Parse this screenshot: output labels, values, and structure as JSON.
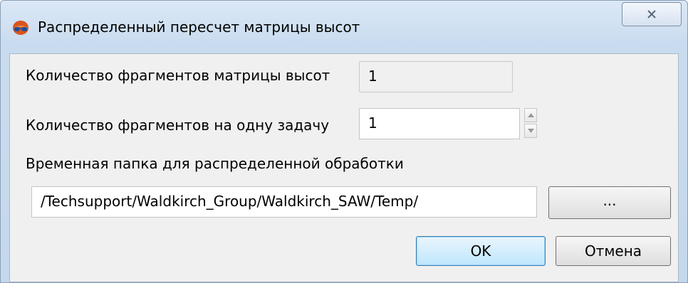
{
  "window": {
    "title": "Распределенный пересчет матрицы высот",
    "icon": "stereo-glasses-icon",
    "close_icon": "close-icon"
  },
  "form": {
    "fragments_count_label": "Количество фрагментов матрицы высот",
    "fragments_count_value": "1",
    "fragments_per_task_label": "Количество фрагментов на одну задачу",
    "fragments_per_task_value": "1",
    "temp_folder_label": "Временная папка для распределенной обработки",
    "temp_folder_value": "/Techsupport/Waldkirch_Group/Waldkirch_SAW/Temp/",
    "browse_label": "..."
  },
  "buttons": {
    "ok_label": "OK",
    "cancel_label": "Отмена"
  }
}
